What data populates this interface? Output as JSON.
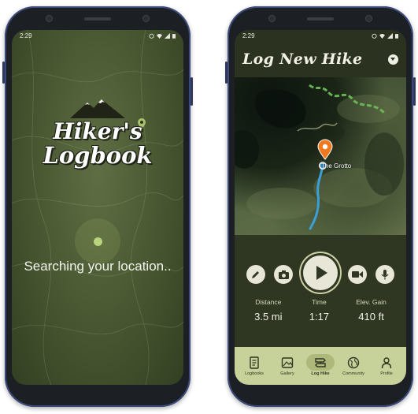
{
  "left_phone": {
    "status_time": "2:29",
    "logo_line1": "Hiker's",
    "logo_line2": "Logbook",
    "message": "Searching your location.."
  },
  "right_phone": {
    "status_time": "2:29",
    "header": {
      "title": "Log New Hike"
    },
    "map": {
      "poi_label": "The Grotto"
    },
    "controls": {
      "edit": "pencil-icon",
      "photo": "camera-icon",
      "record": "play-icon",
      "video": "video-camera-icon",
      "audio": "microphone-icon"
    },
    "stats": [
      {
        "label": "Distance",
        "value": "3.5 mi"
      },
      {
        "label": "Time",
        "value": "1:17"
      },
      {
        "label": "Elev. Gain",
        "value": "410 ft"
      }
    ],
    "tabs": [
      {
        "label": "Logbooks",
        "icon": "book-icon"
      },
      {
        "label": "Gallery",
        "icon": "image-icon"
      },
      {
        "label": "Log Hike",
        "icon": "signpost-icon",
        "active": true
      },
      {
        "label": "Community",
        "icon": "globe-icon"
      },
      {
        "label": "Profile",
        "icon": "person-icon"
      }
    ]
  },
  "colors": {
    "brand_dark": "#2b3220",
    "brand_light": "#c7d19a",
    "accent_pin": "#f0781e",
    "trail": "#3aa0d8"
  }
}
